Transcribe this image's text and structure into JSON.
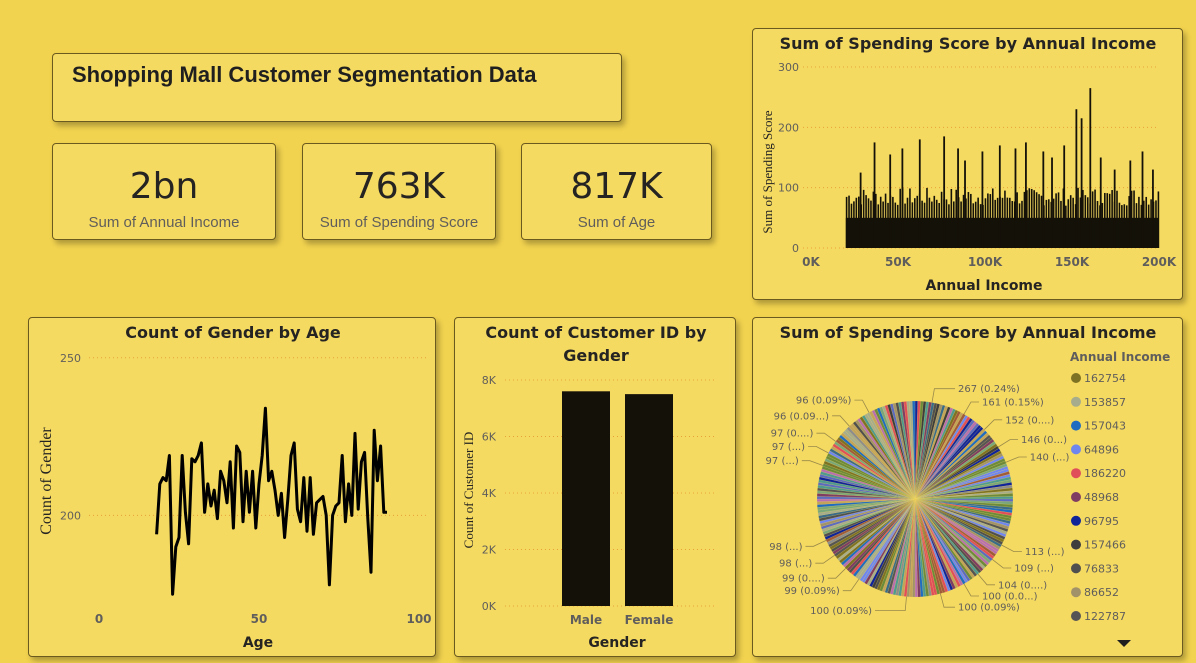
{
  "header": {
    "title": "Shopping Mall Customer Segmentation Data"
  },
  "kpis": [
    {
      "value": "2bn",
      "label": "Sum of Annual Income"
    },
    {
      "value": "763K",
      "label": "Sum of Spending Score"
    },
    {
      "value": "817K",
      "label": "Sum of Age"
    }
  ],
  "colors": {
    "background": "#f2d34f",
    "card": "#f5da61",
    "bar": "#141109",
    "line": "#000000",
    "grid": "#e8a13a"
  },
  "chart_data": [
    {
      "id": "spending-by-income-bar",
      "type": "bar",
      "title": "Sum of Spending Score by Annual Income",
      "xlabel": "Annual Income",
      "ylabel": "Sum of Spending Score",
      "xlim": [
        0,
        200000
      ],
      "ylim": [
        0,
        300
      ],
      "x_ticks": [
        "0K",
        "50K",
        "100K",
        "150K",
        "200K"
      ],
      "y_ticks": [
        "0",
        "100",
        "200",
        "300"
      ],
      "x_tick_values": [
        0,
        50000,
        100000,
        150000,
        200000
      ],
      "y_tick_values": [
        0,
        100,
        200,
        300
      ],
      "x_range_of_bars": [
        20000,
        200000
      ],
      "typical_value_range": [
        50,
        100
      ],
      "peaks": [
        {
          "x": 28000,
          "y": 125
        },
        {
          "x": 36000,
          "y": 175
        },
        {
          "x": 45000,
          "y": 155
        },
        {
          "x": 52000,
          "y": 165
        },
        {
          "x": 62000,
          "y": 180
        },
        {
          "x": 76000,
          "y": 185
        },
        {
          "x": 84000,
          "y": 165
        },
        {
          "x": 88000,
          "y": 145
        },
        {
          "x": 98000,
          "y": 160
        },
        {
          "x": 108000,
          "y": 170
        },
        {
          "x": 117000,
          "y": 165
        },
        {
          "x": 123000,
          "y": 175
        },
        {
          "x": 133000,
          "y": 160
        },
        {
          "x": 138000,
          "y": 150
        },
        {
          "x": 145000,
          "y": 170
        },
        {
          "x": 152000,
          "y": 230
        },
        {
          "x": 155000,
          "y": 215
        },
        {
          "x": 160000,
          "y": 265
        },
        {
          "x": 166000,
          "y": 150
        },
        {
          "x": 174000,
          "y": 130
        },
        {
          "x": 183000,
          "y": 145
        },
        {
          "x": 190000,
          "y": 160
        },
        {
          "x": 196000,
          "y": 130
        }
      ]
    },
    {
      "id": "gender-by-age-line",
      "type": "line",
      "title": "Count of Gender by Age",
      "xlabel": "Age",
      "ylabel": "Count of Gender",
      "xlim": [
        0,
        100
      ],
      "ylim": [
        170,
        255
      ],
      "x_ticks": [
        "0",
        "50",
        "100"
      ],
      "y_ticks": [
        "200",
        "250"
      ],
      "x_tick_values": [
        0,
        50,
        100
      ],
      "y_tick_values": [
        200,
        250
      ],
      "x": [
        18,
        19,
        20,
        21,
        22,
        23,
        24,
        25,
        26,
        27,
        28,
        29,
        30,
        31,
        32,
        33,
        34,
        35,
        36,
        37,
        38,
        39,
        40,
        41,
        42,
        43,
        44,
        45,
        46,
        47,
        48,
        49,
        50,
        51,
        52,
        53,
        54,
        55,
        56,
        57,
        58,
        59,
        60,
        61,
        62,
        63,
        64,
        65,
        66,
        67,
        68,
        69,
        70,
        71,
        72,
        73,
        74,
        75,
        76,
        77,
        78,
        79,
        80,
        81,
        82,
        83,
        84,
        85,
        86,
        87,
        88,
        89,
        90
      ],
      "values": [
        194,
        210,
        212,
        211,
        219,
        175,
        190,
        193,
        219,
        201,
        191,
        218,
        217,
        219,
        223,
        201,
        210,
        203,
        208,
        199,
        214,
        211,
        204,
        217,
        196,
        222,
        220,
        198,
        214,
        201,
        214,
        196,
        210,
        219,
        234,
        211,
        214,
        208,
        200,
        207,
        193,
        205,
        219,
        223,
        202,
        198,
        212,
        195,
        212,
        194,
        204,
        205,
        206,
        200,
        178,
        200,
        203,
        204,
        219,
        198,
        210,
        200,
        226,
        202,
        217,
        220,
        199,
        182,
        227,
        211,
        222,
        201,
        201
      ]
    },
    {
      "id": "customers-by-gender-bar",
      "type": "bar",
      "title": "Count of Customer ID by Gender",
      "xlabel": "Gender",
      "ylabel": "Count of Customer ID",
      "categories": [
        "Male",
        "Female"
      ],
      "values": [
        7600,
        7500
      ],
      "ylim": [
        0,
        8000
      ],
      "y_ticks": [
        "0K",
        "2K",
        "4K",
        "6K",
        "8K"
      ],
      "y_tick_values": [
        0,
        2000,
        4000,
        6000,
        8000
      ]
    },
    {
      "id": "spending-by-income-pie",
      "type": "pie",
      "title": "Sum of Spending Score by Annual Income",
      "legend_title": "Annual Income",
      "legend_placement": "right",
      "legend": [
        {
          "name": "162754",
          "color": "#7d7124"
        },
        {
          "name": "153857",
          "color": "#a7ad8c"
        },
        {
          "name": "157043",
          "color": "#1f6cc0"
        },
        {
          "name": "64896",
          "color": "#6f86ee"
        },
        {
          "name": "186220",
          "color": "#e04e5a"
        },
        {
          "name": "48968",
          "color": "#7f3d63"
        },
        {
          "name": "96795",
          "color": "#10249a"
        },
        {
          "name": "157466",
          "color": "#3d3d3d"
        },
        {
          "name": "76833",
          "color": "#4f4f4f"
        },
        {
          "name": "86652",
          "color": "#a2926a"
        },
        {
          "name": "122787",
          "color": "#555555"
        }
      ],
      "labels": [
        {
          "text": "267 (0.24%)",
          "side": "right",
          "angle": 10
        },
        {
          "text": "161 (0.15%)",
          "side": "right",
          "angle": 30
        },
        {
          "text": "152 (0....)",
          "side": "right",
          "angle": 45
        },
        {
          "text": "146 (0...)",
          "side": "right",
          "angle": 58
        },
        {
          "text": "140 (...)",
          "side": "right",
          "angle": 68
        },
        {
          "text": "113 (...)",
          "side": "right",
          "angle": 118
        },
        {
          "text": "109 (...)",
          "side": "right",
          "angle": 128
        },
        {
          "text": "104 (0....)",
          "side": "right",
          "angle": 140
        },
        {
          "text": "100 (0.0...)",
          "side": "right",
          "angle": 150
        },
        {
          "text": "100 (0.09%)",
          "side": "right",
          "angle": 165
        },
        {
          "text": "100 (0.09%)",
          "side": "left",
          "angle": 185
        },
        {
          "text": "99 (0.09%)",
          "side": "left",
          "angle": 215
        },
        {
          "text": "99 (0....)",
          "side": "left",
          "angle": 225
        },
        {
          "text": "98 (...)",
          "side": "left",
          "angle": 235
        },
        {
          "text": "98 (...)",
          "side": "left",
          "angle": 245
        },
        {
          "text": "97 (...)",
          "side": "left",
          "angle": 290
        },
        {
          "text": "97 (...)",
          "side": "left",
          "angle": 298
        },
        {
          "text": "97 (0....)",
          "side": "left",
          "angle": 306
        },
        {
          "text": "96 (0.09...)",
          "side": "left",
          "angle": 318
        },
        {
          "text": "96 (0.09%)",
          "side": "left",
          "angle": 332
        }
      ]
    }
  ]
}
